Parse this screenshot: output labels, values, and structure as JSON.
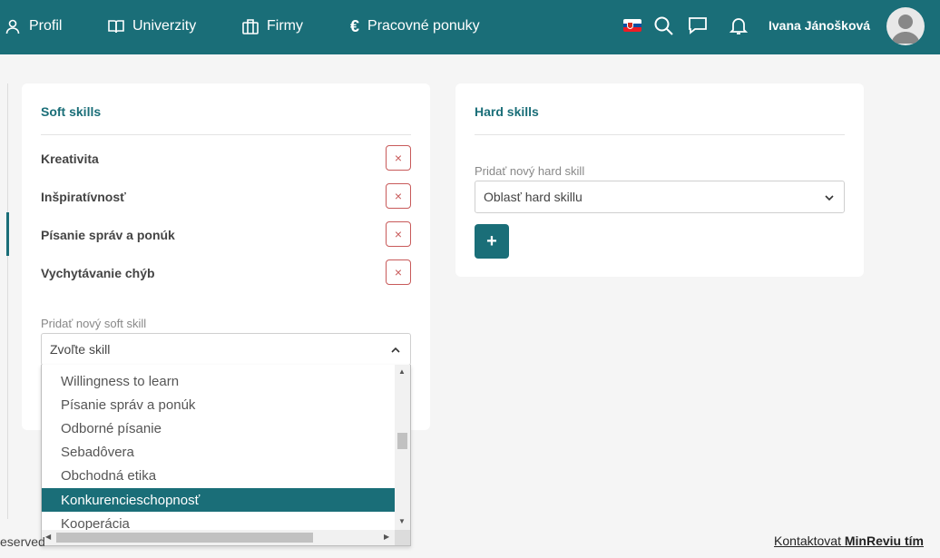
{
  "nav": {
    "profil": "Profil",
    "univerzity": "Univerzity",
    "firmy": "Firmy",
    "ponuky": "Pracovné ponuky",
    "username": "Ivana Jánošková"
  },
  "soft": {
    "title": "Soft skills",
    "skills": [
      {
        "name": "Kreativita",
        "delete": "×"
      },
      {
        "name": "Inšpiratívnosť",
        "delete": "×"
      },
      {
        "name": "Písanie správ a ponúk",
        "delete": "×"
      },
      {
        "name": "Vychytávanie chýb",
        "delete": "×"
      }
    ],
    "add_label": "Pridať nový soft skill",
    "select_value": "Zvoľte skill",
    "options": [
      "Willingness to learn",
      "Písanie správ a ponúk",
      "Odborné písanie",
      "Sebadôvera",
      "Obchodná etika",
      "Konkurencieschopnosť",
      "Kooperácia"
    ],
    "selected_option": "Konkurencieschopnosť"
  },
  "hard": {
    "title": "Hard skills",
    "add_label": "Pridať nový hard skill",
    "select_value": "Oblasť hard skillu",
    "add_button": "+"
  },
  "footer": {
    "left": "eserved",
    "contact": "Kontaktovat",
    "team": "MinReviu tím"
  },
  "colors": {
    "primary": "#1a6e78",
    "danger": "#c85a5a",
    "background": "#f5f5f5"
  }
}
